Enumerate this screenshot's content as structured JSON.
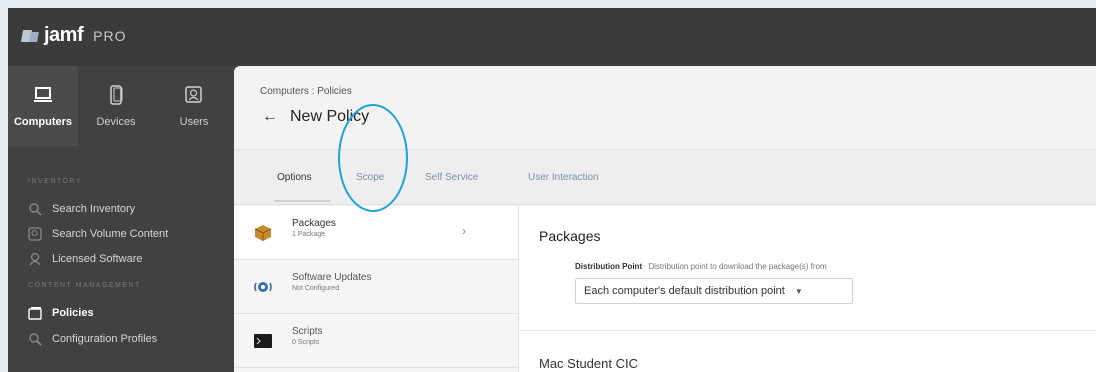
{
  "app": {
    "name": "jamf",
    "edition": "PRO"
  },
  "nav_tabs": [
    {
      "label": "Computers",
      "icon": "laptop-icon",
      "active": true
    },
    {
      "label": "Devices",
      "icon": "mobile-device-icon",
      "active": false
    },
    {
      "label": "Users",
      "icon": "users-icon",
      "active": false
    }
  ],
  "sidebar": {
    "inventory_label": "INVENTORY",
    "content_label": "CONTENT MANAGEMENT",
    "items": [
      {
        "label": "Search Inventory",
        "icon": "search-icon"
      },
      {
        "label": "Search Volume Content",
        "icon": "volume-content-icon"
      },
      {
        "label": "Licensed Software",
        "icon": "licensed-software-icon"
      },
      {
        "label": "Policies",
        "icon": "policies-icon",
        "active": true
      },
      {
        "label": "Configuration Profiles",
        "icon": "configuration-profiles-icon"
      }
    ]
  },
  "breadcrumb": "Computers : Policies",
  "page_title": "New Policy",
  "tabs": [
    {
      "label": "Options",
      "active": true
    },
    {
      "label": "Scope"
    },
    {
      "label": "Self Service"
    },
    {
      "label": "User Interaction"
    }
  ],
  "payloads": [
    {
      "label": "Packages",
      "sub": "1 Package",
      "icon": "package-icon",
      "selected": true
    },
    {
      "label": "Software Updates",
      "sub": "Not Configured",
      "icon": "software-updates-icon"
    },
    {
      "label": "Scripts",
      "sub": "0 Scripts",
      "icon": "scripts-icon"
    }
  ],
  "content": {
    "title": "Packages",
    "distribution_label": "Distribution Point",
    "distribution_help": "Distribution point to download the package(s) from",
    "distribution_value": "Each computer's default distribution point",
    "package_name": "Mac Student CIC"
  },
  "colors": {
    "annotation_circle": "#1ea3d6",
    "sidebar_bg": "#414141",
    "topbar_bg": "#3b3b3b"
  }
}
